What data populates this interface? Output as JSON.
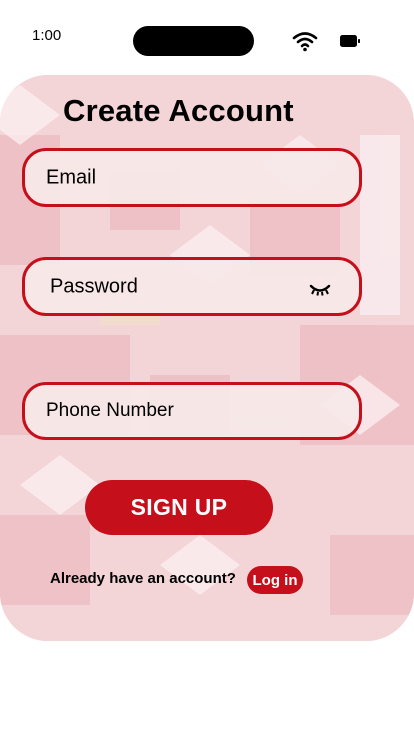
{
  "status_bar": {
    "time": "1:00",
    "icons": [
      "wifi-icon",
      "battery-icon"
    ]
  },
  "form": {
    "title": "Create Account",
    "email_placeholder": "Email",
    "password_placeholder": "Password",
    "password_toggle_icon": "eye-closed-icon",
    "phone_placeholder": "Phone Number",
    "signup_label": "SIGN UP"
  },
  "footer": {
    "prompt": "Already have an account?",
    "login_label": "Log in"
  },
  "colors": {
    "accent": "#c50f1a",
    "card_background": "#f4d7da",
    "field_background": "#f6e8e8"
  }
}
